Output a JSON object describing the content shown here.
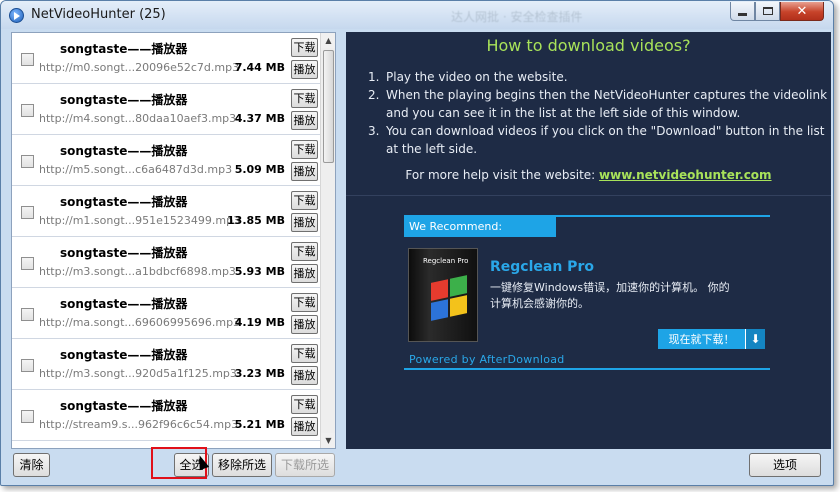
{
  "window": {
    "title": "NetVideoHunter (25)",
    "background_blur_text": "达人网批 · 安全检查插件"
  },
  "list": {
    "download_label": "下载",
    "play_label": "播放",
    "items": [
      {
        "title": "songtaste——播放器",
        "url": "http://m0.songt...20096e52c7d.mp3",
        "size": "7.44 MB"
      },
      {
        "title": "songtaste——播放器",
        "url": "http://m4.songt...80daa10aef3.mp3",
        "size": "4.37 MB"
      },
      {
        "title": "songtaste——播放器",
        "url": "http://m5.songt...c6a6487d3d.mp3",
        "size": "5.09 MB"
      },
      {
        "title": "songtaste——播放器",
        "url": "http://m1.songt...951e1523499.mp3",
        "size": "13.85 MB"
      },
      {
        "title": "songtaste——播放器",
        "url": "http://m3.songt...a1bdbcf6898.mp3",
        "size": "5.93 MB"
      },
      {
        "title": "songtaste——播放器",
        "url": "http://ma.songt...69606995696.mp3",
        "size": "4.19 MB"
      },
      {
        "title": "songtaste——播放器",
        "url": "http://m3.songt...920d5a1f125.mp3",
        "size": "3.23 MB"
      },
      {
        "title": "songtaste——播放器",
        "url": "http://stream9.s...962f96c6c54.mp3",
        "size": "5.21 MB"
      }
    ]
  },
  "info": {
    "heading": "How to download videos?",
    "steps": [
      {
        "num": "1.",
        "text": "Play the video on the website."
      },
      {
        "num": "2.",
        "text": "When the playing begins then the NetVideoHunter captures the videolink and you can see it in the list at the left side of this window."
      },
      {
        "num": "3.",
        "text": "You can download videos if you click on the \"Download\" button in the list at the left side."
      }
    ],
    "help_prefix": "For more help visit the website:",
    "help_link": "www.netvideohunter.com"
  },
  "ad": {
    "header": "We Recommend:",
    "product_name": "Regclean Pro",
    "product_box_label": "Regclean Pro",
    "description": "一键修复Windows错误，加速你的计算机。 你的计算机会感谢你的。",
    "download_label": "现在就下载！",
    "download_icon": "download-arrow-icon",
    "powered_by": "Powered by AfterDownload"
  },
  "toolbar": {
    "clear": "清除",
    "select_all": "全选",
    "remove_selected": "移除所选",
    "download_selected": "下载所选",
    "options": "选项"
  },
  "colors": {
    "info_bg": "#1e2b45",
    "accent_green": "#a8e25a",
    "ad_blue": "#1ea4e6",
    "highlight_red": "#e0101a"
  }
}
